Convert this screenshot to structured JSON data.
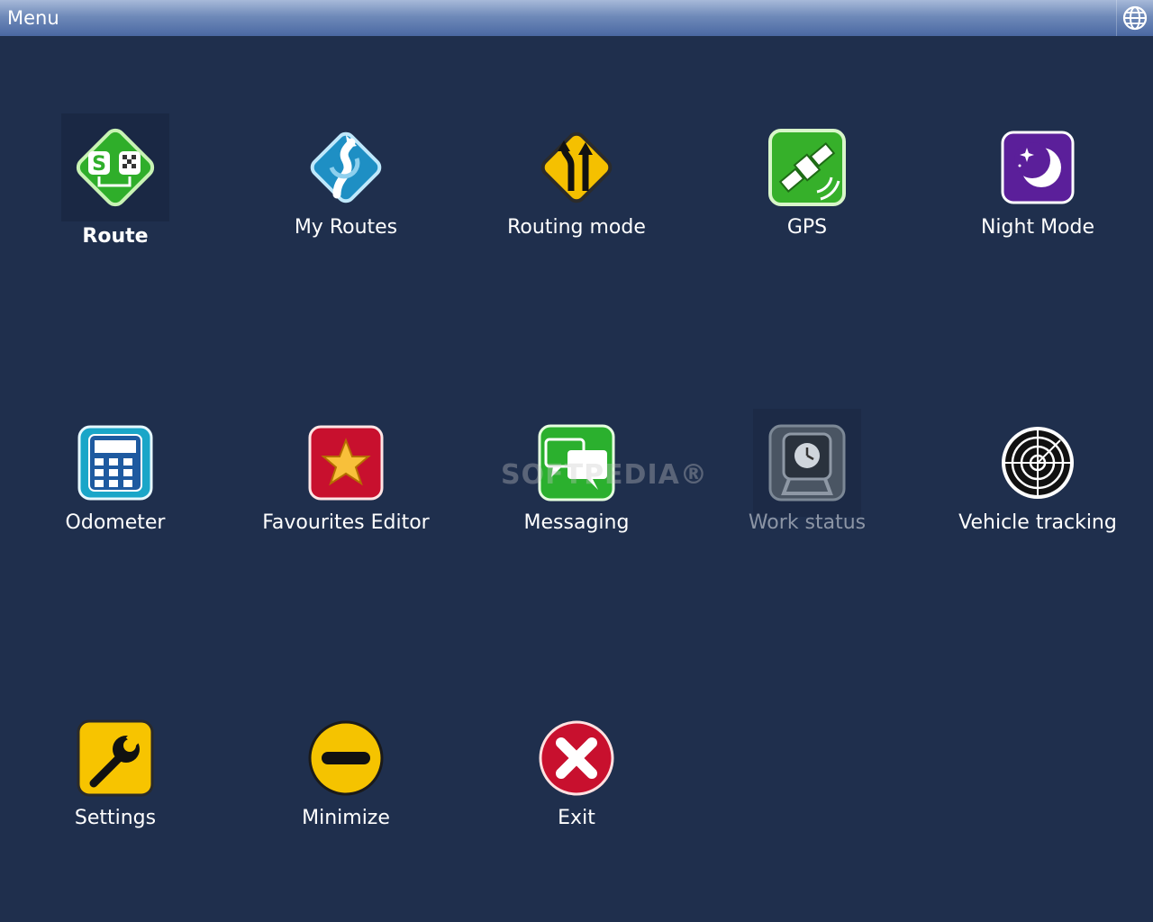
{
  "window": {
    "title": "Menu",
    "globe_icon": "globe-icon"
  },
  "items": [
    {
      "label": "Route",
      "icon": "route-icon",
      "selected": true
    },
    {
      "label": "My Routes",
      "icon": "my-routes-icon"
    },
    {
      "label": "Routing mode",
      "icon": "routing-mode-icon"
    },
    {
      "label": "GPS",
      "icon": "gps-satellite-icon"
    },
    {
      "label": "Night Mode",
      "icon": "night-mode-moon-icon"
    },
    {
      "label": "Odometer",
      "icon": "odometer-calculator-icon"
    },
    {
      "label": "Favourites Editor",
      "icon": "favourites-star-icon"
    },
    {
      "label": "Messaging",
      "icon": "messaging-bubbles-icon"
    },
    {
      "label": "Work status",
      "icon": "work-status-clock-icon",
      "disabled": true
    },
    {
      "label": "Vehicle tracking",
      "icon": "vehicle-tracking-radar-icon"
    },
    {
      "label": "Settings",
      "icon": "settings-wrench-icon"
    },
    {
      "label": "Minimize",
      "icon": "minimize-icon"
    },
    {
      "label": "Exit",
      "icon": "exit-icon"
    }
  ],
  "watermark": "SOFTPEDIA®",
  "colors": {
    "background": "#1f2f4d",
    "titlebar": "#5a76ad",
    "disabled_text": "#8c95a5"
  }
}
